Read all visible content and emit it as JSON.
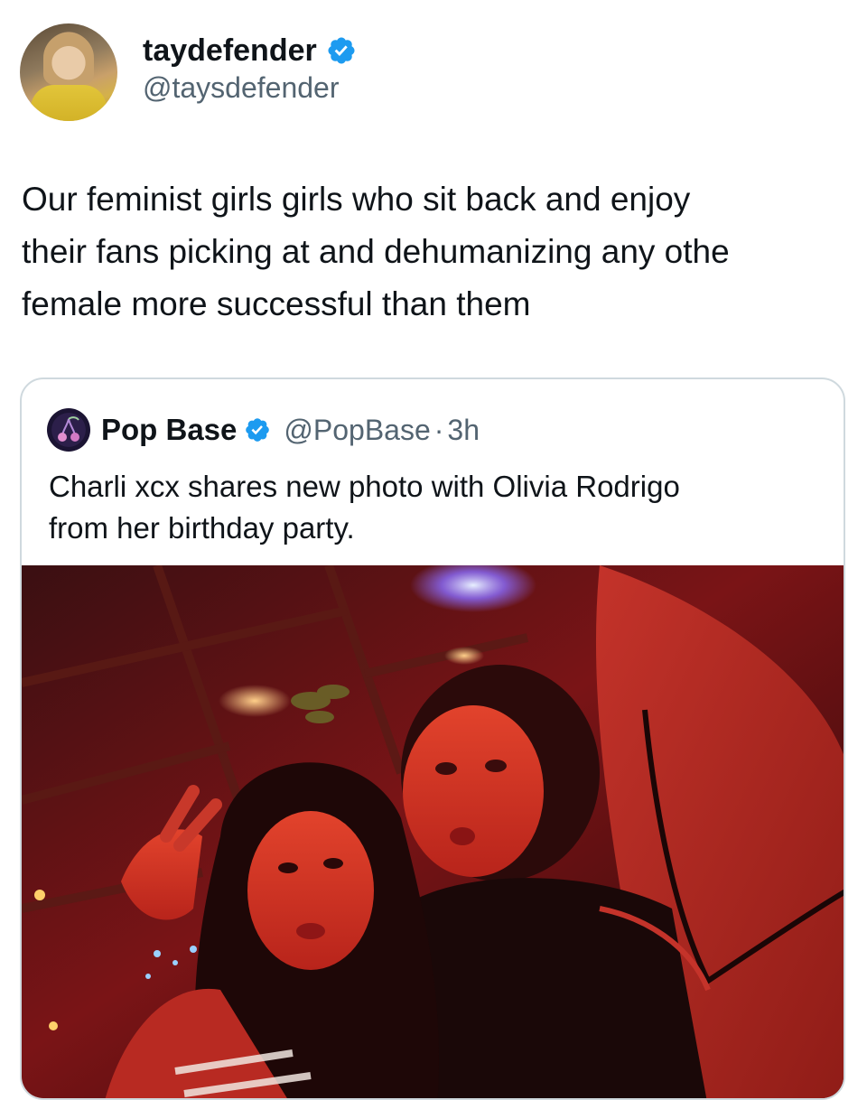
{
  "post": {
    "author": {
      "display_name": "taydefender",
      "handle": "@taysdefender",
      "verified": true
    },
    "text": "Our feminist girls girls who sit back and enjoy\ntheir fans picking at and dehumanizing any othe\nfemale more successful than them"
  },
  "quote": {
    "author": {
      "display_name": "Pop Base",
      "handle": "@PopBase",
      "verified": true
    },
    "separator": "·",
    "time": "3h",
    "text": "Charli xcx shares new photo with Olivia Rodrigo\nfrom her birthday party."
  },
  "colors": {
    "verified_blue": "#1d9bf0",
    "secondary_text": "#536471",
    "border": "#cfd9de"
  },
  "icons": {
    "verified": "verified-badge-icon"
  }
}
